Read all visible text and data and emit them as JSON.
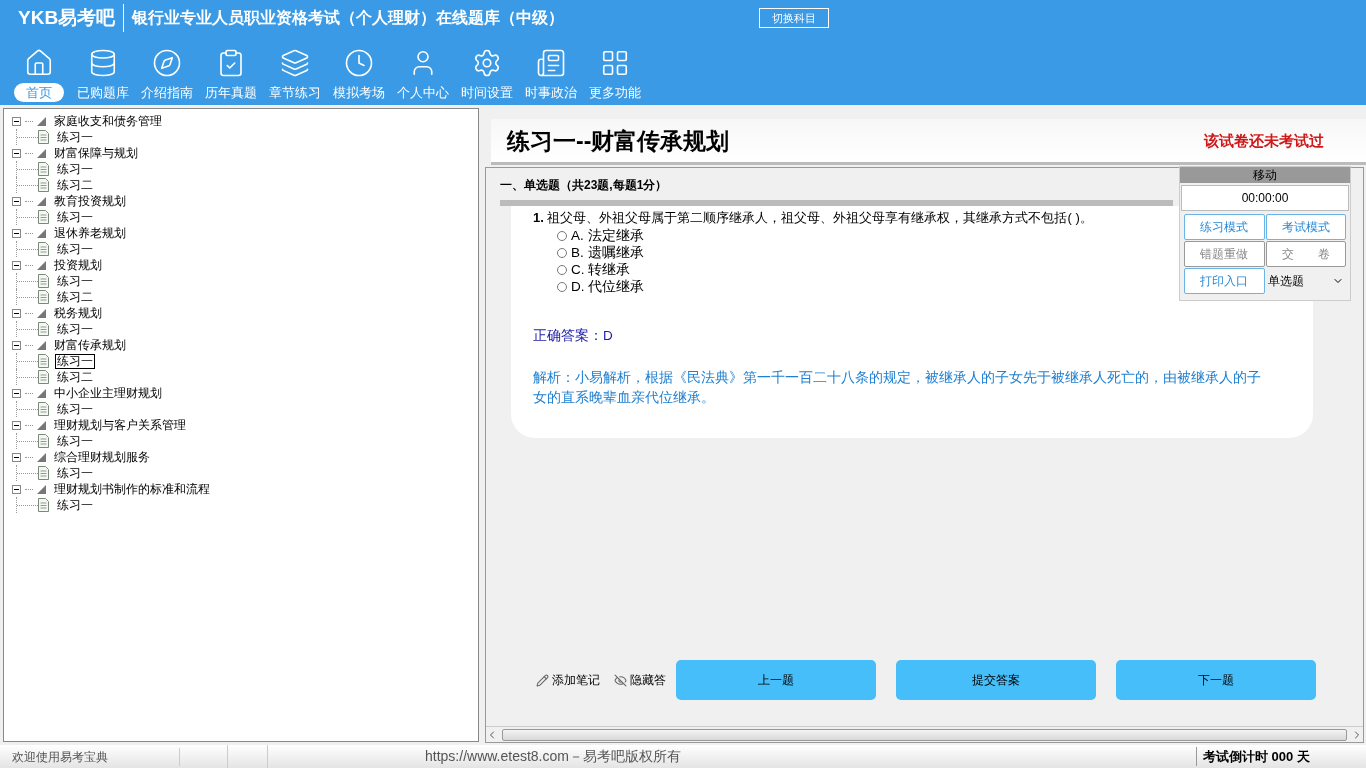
{
  "header": {
    "logo": "YKB易考吧",
    "title": "银行业专业人员职业资格考试（个人理财）在线题库（中级）",
    "switch_button": "切换科目"
  },
  "toolbar": [
    {
      "label": "首页",
      "selected": true
    },
    {
      "label": "已购题库",
      "selected": false
    },
    {
      "label": "介绍指南",
      "selected": false
    },
    {
      "label": "历年真题",
      "selected": false
    },
    {
      "label": "章节练习",
      "selected": false
    },
    {
      "label": "模拟考场",
      "selected": false
    },
    {
      "label": "个人中心",
      "selected": false
    },
    {
      "label": "时间设置",
      "selected": false
    },
    {
      "label": "时事政治",
      "selected": false
    },
    {
      "label": "更多功能",
      "selected": false
    }
  ],
  "tree": [
    {
      "label": "家庭收支和债务管理",
      "expanded": true,
      "children": [
        {
          "label": "练习一",
          "selected": false
        }
      ]
    },
    {
      "label": "财富保障与规划",
      "expanded": true,
      "children": [
        {
          "label": "练习一",
          "selected": false
        },
        {
          "label": "练习二",
          "selected": false
        }
      ]
    },
    {
      "label": "教育投资规划",
      "expanded": true,
      "children": [
        {
          "label": "练习一",
          "selected": false
        }
      ]
    },
    {
      "label": "退休养老规划",
      "expanded": true,
      "children": [
        {
          "label": "练习一",
          "selected": false
        }
      ]
    },
    {
      "label": "投资规划",
      "expanded": true,
      "children": [
        {
          "label": "练习一",
          "selected": false
        },
        {
          "label": "练习二",
          "selected": false
        }
      ]
    },
    {
      "label": "税务规划",
      "expanded": true,
      "children": [
        {
          "label": "练习一",
          "selected": false
        }
      ]
    },
    {
      "label": "财富传承规划",
      "expanded": true,
      "children": [
        {
          "label": "练习一",
          "selected": true
        },
        {
          "label": "练习二",
          "selected": false
        }
      ]
    },
    {
      "label": "中小企业主理财规划",
      "expanded": true,
      "children": [
        {
          "label": "练习一",
          "selected": false
        }
      ]
    },
    {
      "label": "理财规划与客户关系管理",
      "expanded": true,
      "children": [
        {
          "label": "练习一",
          "selected": false
        }
      ]
    },
    {
      "label": "综合理财规划服务",
      "expanded": true,
      "children": [
        {
          "label": "练习一",
          "selected": false
        }
      ]
    },
    {
      "label": "理财规划书制作的标准和流程",
      "expanded": true,
      "children": [
        {
          "label": "练习一",
          "selected": false
        }
      ]
    }
  ],
  "paper": {
    "title": "练习一--财富传承规划",
    "status": "该试卷还未考试过",
    "section": "一、单选题（共23题,每题1分）",
    "question": {
      "number": "1.",
      "text": "祖父母、外祖父母属于第二顺序继承人，祖父母、外祖父母享有继承权，其继承方式不包括( )。",
      "options": [
        {
          "label": "A.",
          "text": "法定继承",
          "selected": false
        },
        {
          "label": "B.",
          "text": "遗嘱继承",
          "selected": false
        },
        {
          "label": "C.",
          "text": "转继承",
          "selected": false
        },
        {
          "label": "D.",
          "text": "代位继承",
          "selected": false
        }
      ]
    },
    "answer": "正确答案：D",
    "analysis": "解析：小易解析，根据《民法典》第一千一百二十八条的规定，被继承人的子女先于被继承人死亡的，由被继承人的子女的直系晚辈血亲代位继承。"
  },
  "side_panel": {
    "header": "移动",
    "timer": "00:00:00",
    "buttons": [
      {
        "label": "练习模式",
        "disabled": false
      },
      {
        "label": "考试模式",
        "disabled": false
      },
      {
        "label": "错题重做",
        "disabled": true
      },
      {
        "label": "交　　卷",
        "disabled": true
      },
      {
        "label": "打印入口",
        "disabled": false
      }
    ],
    "select": "单选题"
  },
  "actions": {
    "note": "添加笔记",
    "hide": "隐藏答",
    "buttons": [
      "上一题",
      "提交答案",
      "下一题"
    ]
  },
  "status_bar": {
    "welcome": "欢迎使用易考宝典",
    "url": "https://www.etest8.com－易考吧版权所有",
    "countdown": "考试倒计时 000 天"
  }
}
